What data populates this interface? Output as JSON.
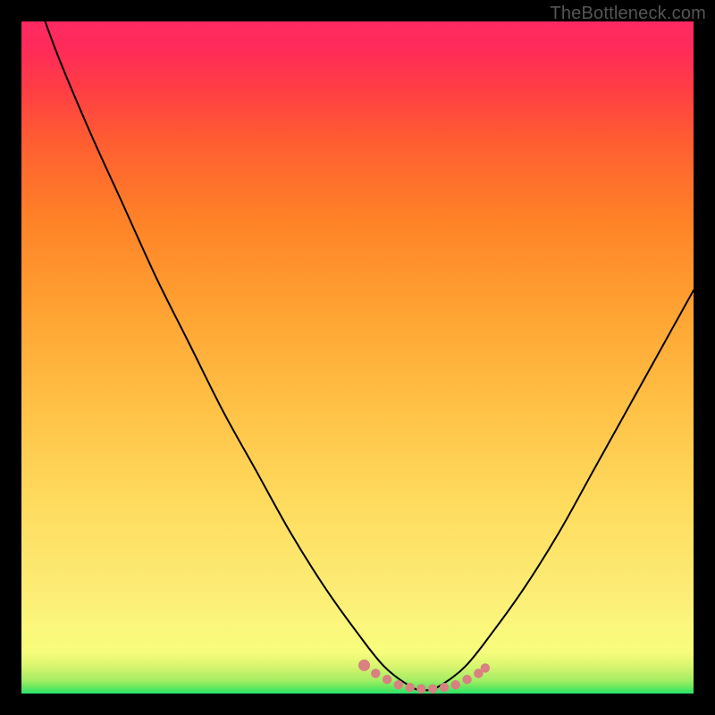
{
  "watermark": "TheBottleneck.com",
  "chart_data": {
    "type": "line",
    "title": "",
    "xlabel": "",
    "ylabel": "",
    "xlim": [
      0,
      100
    ],
    "ylim": [
      0,
      100
    ],
    "series": [
      {
        "name": "bottleneck-curve",
        "x": [
          0,
          5,
          10,
          15,
          20,
          25,
          30,
          35,
          40,
          45,
          50,
          54,
          58,
          60,
          62,
          66,
          70,
          75,
          80,
          85,
          90,
          95,
          100
        ],
        "values": [
          110,
          96,
          84,
          73,
          62,
          52,
          42,
          33,
          24,
          16,
          9,
          4,
          1,
          0.5,
          1,
          4,
          9,
          16,
          24,
          33,
          42,
          51,
          60
        ]
      },
      {
        "name": "optimal-range-dots",
        "x": [
          51,
          52.7,
          54.4,
          56.1,
          57.8,
          59.5,
          61.2,
          62.9,
          64.6,
          66.3,
          68,
          69
        ],
        "values": [
          4.2,
          3.0,
          2.1,
          1.3,
          0.9,
          0.7,
          0.7,
          0.9,
          1.3,
          2.1,
          3.0,
          3.8
        ]
      }
    ],
    "marker_color": "#d98080",
    "curve_color": "#000000"
  }
}
